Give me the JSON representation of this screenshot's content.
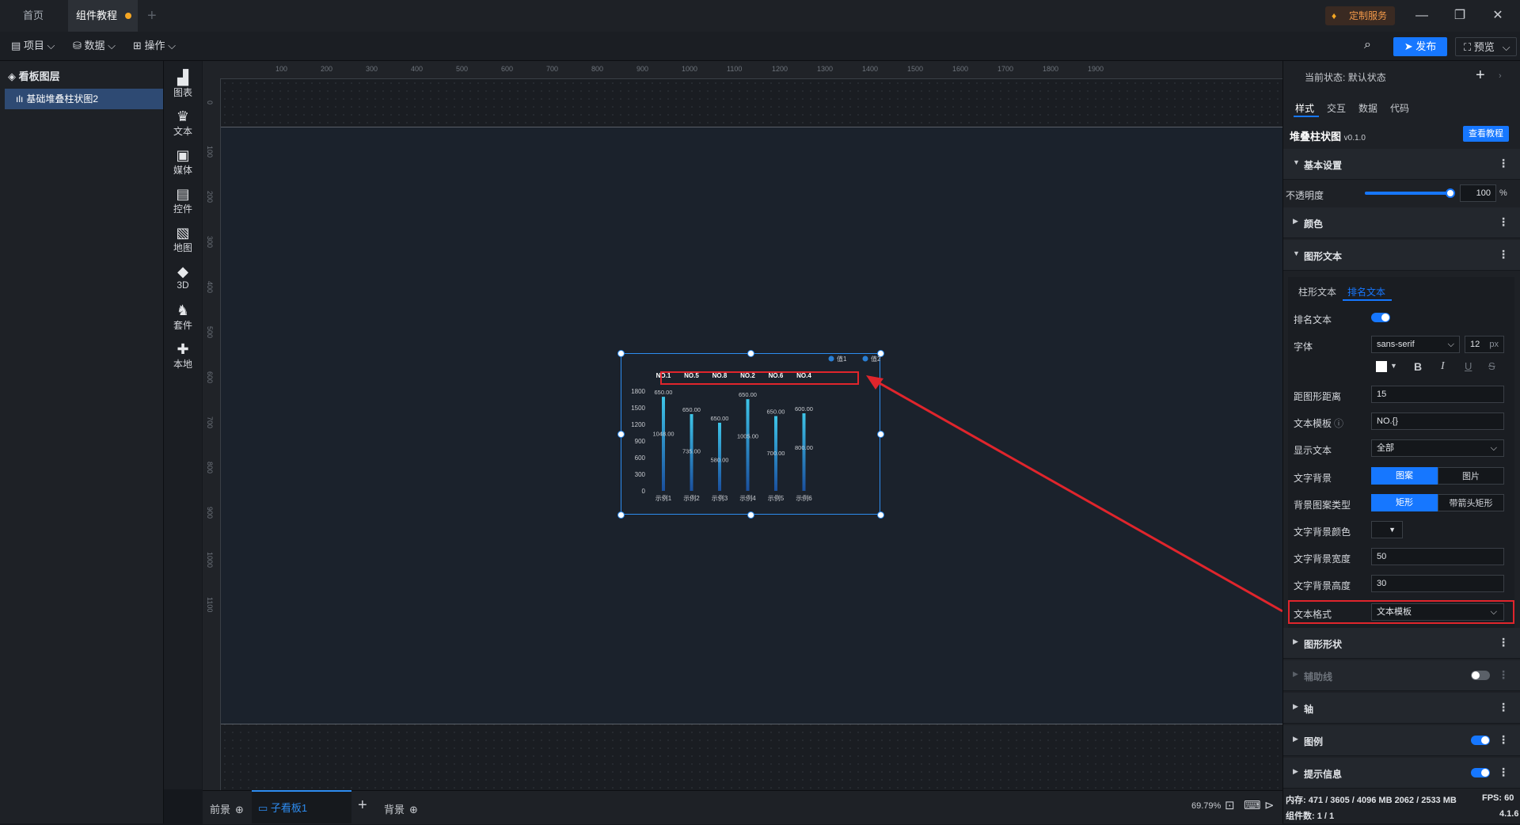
{
  "titlebar": {
    "tabs": [
      "首页",
      "组件教程"
    ],
    "custom_service": "定制服务",
    "controls": [
      "—",
      "❐",
      "✕"
    ]
  },
  "toolbar": {
    "menus": [
      "项目",
      "数据",
      "操作"
    ],
    "publish": "发布",
    "preview": "预览"
  },
  "layers": {
    "title": "看板图层",
    "items": [
      "基础堆叠柱状图2"
    ]
  },
  "rail": [
    {
      "label": "图表",
      "icon": "bar-chart-icon"
    },
    {
      "label": "文本",
      "icon": "text-icon"
    },
    {
      "label": "媒体",
      "icon": "media-icon"
    },
    {
      "label": "控件",
      "icon": "widget-icon"
    },
    {
      "label": "地图",
      "icon": "map-icon"
    },
    {
      "label": "3D",
      "icon": "cube-icon"
    },
    {
      "label": "套件",
      "icon": "suite-icon"
    },
    {
      "label": "本地",
      "icon": "puzzle-icon"
    }
  ],
  "ruler": {
    "top": [
      "100",
      "200",
      "300",
      "400",
      "500",
      "600",
      "700",
      "800",
      "900",
      "1000",
      "1100",
      "1200",
      "1300",
      "1400",
      "1500",
      "1600",
      "1700",
      "1800",
      "1900"
    ],
    "left": [
      "0",
      "100",
      "200",
      "300",
      "400",
      "500",
      "600",
      "700",
      "800",
      "900",
      "1000",
      "1100"
    ]
  },
  "chart_data": {
    "type": "bar",
    "categories": [
      "示例1",
      "示例2",
      "示例3",
      "示例4",
      "示例5",
      "示例6"
    ],
    "rank_labels": [
      "NO.1",
      "NO.5",
      "NO.8",
      "NO.2",
      "NO.6",
      "NO.4"
    ],
    "legend": [
      "值1",
      "值2"
    ],
    "yticks": [
      "1800",
      "1500",
      "1200",
      "900",
      "600",
      "300",
      "0"
    ],
    "ylim": [
      0,
      1800
    ],
    "series": [
      {
        "name": "值1",
        "values": [
          1048.0,
          735.0,
          580.0,
          1005.0,
          700.0,
          800.0
        ],
        "labels": [
          "1048.00",
          "735.00",
          "580.00",
          "1005.00",
          "700.00",
          "800.00"
        ]
      },
      {
        "name": "值2",
        "values": [
          650.0,
          650.0,
          650.0,
          650.0,
          650.0,
          600.0
        ],
        "labels": [
          "650.00",
          "650.00",
          "650.00",
          "650.00",
          "650.00",
          "600.00"
        ]
      }
    ],
    "colors": {
      "bar_top": "#3ec5e8",
      "bar_bottom": "#1a4f9e"
    }
  },
  "bottombar": {
    "foreground": "前景",
    "sub_board": "子看板1",
    "add": "+",
    "background": "背景",
    "zoom": "69.79%"
  },
  "panel": {
    "current_state_label": "当前状态:",
    "current_state_value": "默认状态",
    "tabs": [
      "样式",
      "交互",
      "数据",
      "代码"
    ],
    "component_name": "堆叠柱状图",
    "version": "v0.1.0",
    "tutorial_btn": "查看教程",
    "sections": {
      "basic": "基本设置",
      "color": "颜色",
      "graph_text": "图形文本",
      "graph_shape": "图形形状",
      "aux_line": "辅助线",
      "axis": "轴",
      "legend": "图例",
      "tooltip": "提示信息"
    },
    "opacity_label": "不透明度",
    "opacity_value": "100",
    "opacity_unit": "%",
    "opacity_level": 1.0,
    "subtabs": [
      "柱形文本",
      "排名文本"
    ],
    "rows": {
      "rank_text": "排名文本",
      "font": "字体",
      "font_value": "sans-serif",
      "font_size": "12",
      "font_unit": "px",
      "distance": "距图形距离",
      "distance_value": "15",
      "template": "文本模板",
      "template_value": "NO.{}",
      "display_text": "显示文本",
      "display_value": "全部",
      "text_bg": "文字背景",
      "text_bg_opts": [
        "图案",
        "图片"
      ],
      "bg_pattern_type": "背景图案类型",
      "bg_pattern_opts": [
        "矩形",
        "带箭头矩形"
      ],
      "bg_color": "文字背景颜色",
      "bg_width": "文字背景宽度",
      "bg_width_value": "50",
      "bg_height": "文字背景高度",
      "bg_height_value": "30",
      "text_format": "文本格式",
      "text_format_value": "文本模板"
    },
    "status_mem": "内存: 471 / 3605 / 4096 MB 2062 / 2533 MB",
    "status_fps": "FPS: 60",
    "status_count": "组件数: 1 / 1",
    "status_version": "4.1.6"
  }
}
